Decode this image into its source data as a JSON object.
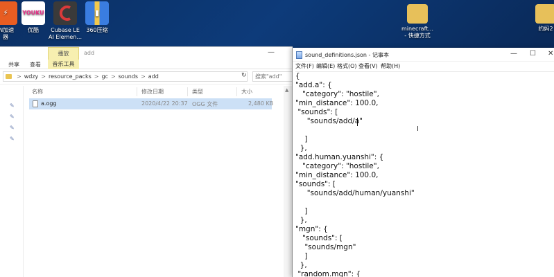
{
  "desktop": {
    "icons": [
      {
        "label": "IN加速\n器",
        "color": "#e85d22"
      },
      {
        "label": "优酷",
        "color": "#e8308a",
        "text": "YOUKU"
      },
      {
        "label": "Cubase LE\nAI Elemen...",
        "color": "#c72a2a"
      },
      {
        "label": "360压缩",
        "color": "#2d6fd1"
      },
      {
        "label": "minecraft...\n- 快捷方式",
        "color": "#e7c05a"
      },
      {
        "label": "约妈2",
        "color": "#e7c05a"
      }
    ]
  },
  "explorer": {
    "context_tab": "播放",
    "folder_title": "add",
    "minimize_glyph": "—",
    "ribbon": {
      "share": "共享",
      "view": "查看",
      "music_tools": "音乐工具"
    },
    "breadcrumb": [
      "wdzy",
      "resource_packs",
      "gc",
      "sounds",
      "add"
    ],
    "breadcrumb_sep": ">",
    "search_placeholder": "搜索\"add\"",
    "refresh_glyph": "↻",
    "columns": {
      "name": "名称",
      "modified": "修改日期",
      "type": "类型",
      "size": "大小"
    },
    "files": [
      {
        "name": "a.ogg",
        "modified": "2020/4/22 20:37",
        "type": "OGG 文件",
        "size": "2,480 KB"
      }
    ]
  },
  "notepad": {
    "title": "sound_definitions.json - 记事本",
    "controls": {
      "minimize": "—",
      "maximize": "☐",
      "close": "✕"
    },
    "menu": [
      "文件(F)",
      "编辑(E)",
      "格式(O)",
      "查看(V)",
      "帮助(H)"
    ],
    "lines": [
      "{",
      "\"add.a\": {",
      "   \"category\": \"hostile\",",
      "\"min_distance\": 100.0,",
      " \"sounds\": [",
      "     \"sounds/add/a\"",
      "",
      "    ]",
      "  },",
      "\"add.human.yuanshi\": {",
      "   \"category\": \"hostile\",",
      "\"min_distance\": 100.0,",
      "\"sounds\": [",
      "     \"sounds/add/human/yuanshi\"",
      "",
      "    ]",
      "  },",
      "\"mgn\": {",
      "   \"sounds\": [",
      "    \"sounds/mgn\"",
      "    ]",
      "  },",
      " \"random.mgn\": {"
    ]
  }
}
